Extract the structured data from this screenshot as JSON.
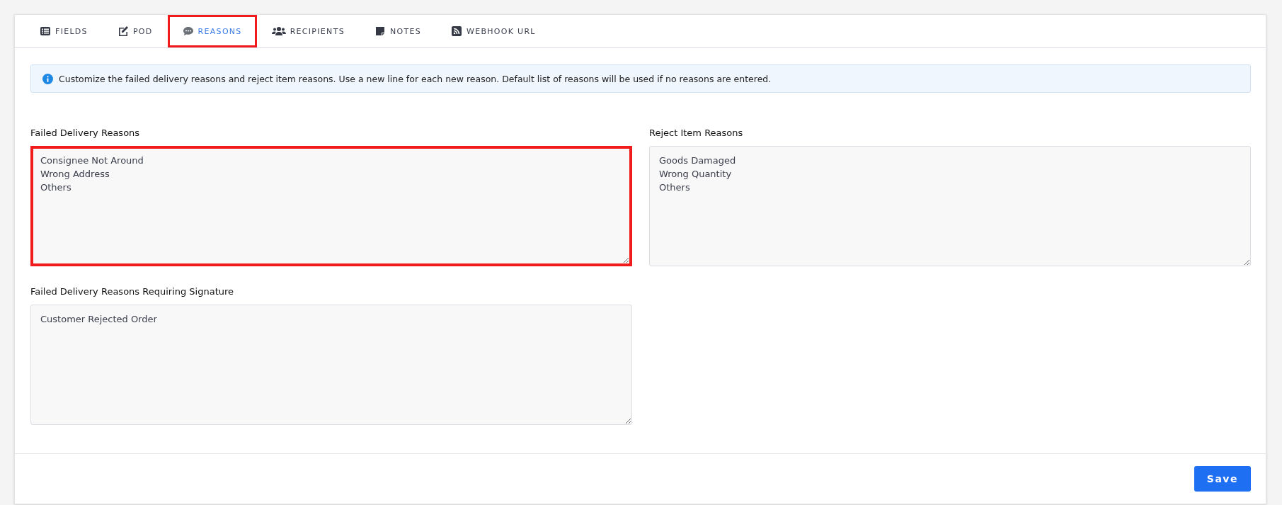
{
  "tabs": [
    {
      "label": "FIELDS",
      "kind": "list",
      "selected": false,
      "highlighted": false
    },
    {
      "label": "POD",
      "kind": "edit",
      "selected": false,
      "highlighted": false
    },
    {
      "label": "REASONS",
      "kind": "comment",
      "selected": true,
      "highlighted": true
    },
    {
      "label": "RECIPIENTS",
      "kind": "users",
      "selected": false,
      "highlighted": false
    },
    {
      "label": "NOTES",
      "kind": "note",
      "selected": false,
      "highlighted": false
    },
    {
      "label": "WEBHOOK URL",
      "kind": "rss",
      "selected": false,
      "highlighted": false
    }
  ],
  "info": "Customize the failed delivery reasons and reject item reasons. Use a new line for each new reason. Default list of reasons will be used if no reasons are entered.",
  "fields": [
    {
      "label": "Failed Delivery Reasons",
      "value": "Consignee Not Around\nWrong Address\nOthers",
      "highlighted": true
    },
    {
      "label": "Reject Item Reasons",
      "value": "Goods Damaged\nWrong Quantity\nOthers",
      "highlighted": false
    },
    {
      "label": "Failed Delivery Reasons Requiring Signature",
      "value": "Customer Rejected Order",
      "highlighted": false
    }
  ],
  "save_button": "Save"
}
